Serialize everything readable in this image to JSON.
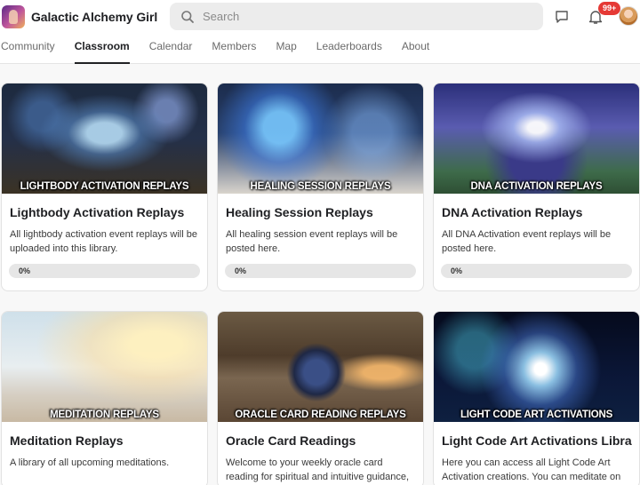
{
  "app": {
    "name": "Galactic Alchemy Girl"
  },
  "search": {
    "placeholder": "Search"
  },
  "notifications": {
    "badge": "99+"
  },
  "tabs": [
    {
      "label": "Community"
    },
    {
      "label": "Classroom",
      "active": true
    },
    {
      "label": "Calendar"
    },
    {
      "label": "Members"
    },
    {
      "label": "Map"
    },
    {
      "label": "Leaderboards"
    },
    {
      "label": "About"
    }
  ],
  "colors": {
    "accent": "#202124",
    "badge": "#e53935",
    "progress_track": "#e6e6e6"
  },
  "courses": [
    {
      "thumbnail_caption": "LIGHTBODY ACTIVATION REPLAYS",
      "title": "Lightbody Activation Replays",
      "description": "All lightbody activation event replays will be uploaded into this library.",
      "progress": "0%"
    },
    {
      "thumbnail_caption": "HEALING SESSION REPLAYS",
      "title": "Healing Session Replays",
      "description": "All healing session event replays will be posted here.",
      "progress": "0%"
    },
    {
      "thumbnail_caption": "DNA ACTIVATION REPLAYS",
      "title": "DNA Activation Replays",
      "description": "All DNA Activation event replays will be posted here.",
      "progress": "0%"
    },
    {
      "thumbnail_caption": "MEDITATION REPLAYS",
      "title": "Meditation Replays",
      "description": "A library of all upcoming meditations."
    },
    {
      "thumbnail_caption": "ORACLE CARD READING REPLAYS",
      "title": "Oracle Card Readings",
      "description": "Welcome to your weekly oracle card reading for spiritual and intuitive guidance, insights,..."
    },
    {
      "thumbnail_caption": "LIGHT CODE ART ACTIVATIONS",
      "title": "Light Code Art Activations Library",
      "description": "Here you can access all Light Code Art Activation creations. You can meditate on t..."
    }
  ]
}
